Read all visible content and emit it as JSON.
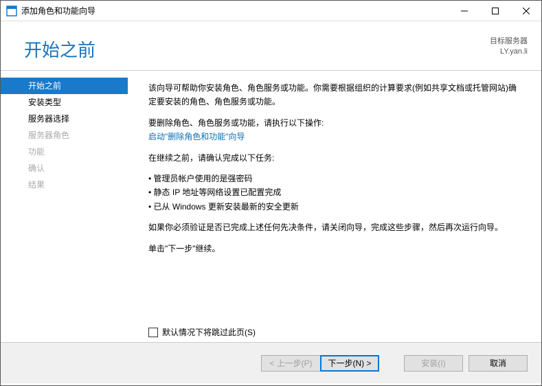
{
  "window": {
    "title": "添加角色和功能向导"
  },
  "header": {
    "page_title": "开始之前",
    "target_label": "目标服务器",
    "target_value": "LY.yan.li"
  },
  "sidebar": {
    "items": [
      {
        "label": "开始之前",
        "state": "active"
      },
      {
        "label": "安装类型",
        "state": "enabled"
      },
      {
        "label": "服务器选择",
        "state": "enabled"
      },
      {
        "label": "服务器角色",
        "state": "disabled"
      },
      {
        "label": "功能",
        "state": "disabled"
      },
      {
        "label": "确认",
        "state": "disabled"
      },
      {
        "label": "结果",
        "state": "disabled"
      }
    ]
  },
  "content": {
    "intro": "该向导可帮助你安装角色、角色服务或功能。你需要根据组织的计算要求(例如共享文档或托管网站)确定要安装的角色、角色服务或功能。",
    "remove_label": "要删除角色、角色服务或功能，请执行以下操作:",
    "remove_link": "启动\"删除角色和功能\"向导",
    "before_label": "在继续之前，请确认完成以下任务:",
    "bullets": [
      "管理员帐户使用的是强密码",
      "静态 IP 地址等网络设置已配置完成",
      "已从 Windows 更新安装最新的安全更新"
    ],
    "verify_text": "如果你必须验证是否已完成上述任何先决条件，请关闭向导，完成这些步骤，然后再次运行向导。",
    "continue_text": "单击\"下一步\"继续。",
    "skip_label": "默认情况下将跳过此页(S)"
  },
  "footer": {
    "prev": "< 上一步(P)",
    "next": "下一步(N) >",
    "install": "安装(I)",
    "cancel": "取消"
  }
}
